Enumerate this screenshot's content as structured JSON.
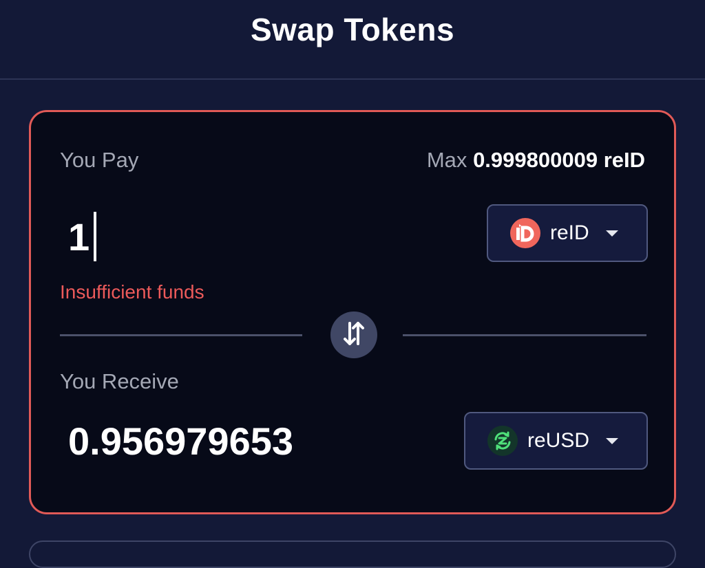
{
  "header": {
    "title": "Swap Tokens"
  },
  "pay": {
    "label": "You Pay",
    "max_label": "Max",
    "max_value": "0.999800009 reID",
    "amount": "1",
    "error": "Insufficient funds",
    "token": {
      "name": "reID",
      "icon": "reid-logo-icon"
    }
  },
  "receive": {
    "label": "You Receive",
    "amount": "0.956979653",
    "token": {
      "name": "reUSD",
      "icon": "reusd-logo-icon"
    }
  },
  "colors": {
    "background": "#131937",
    "card": "#070a18",
    "card_border_error": "#e15a57",
    "error_text": "#ec5a5a",
    "token_select_bg": "#151b3d"
  }
}
